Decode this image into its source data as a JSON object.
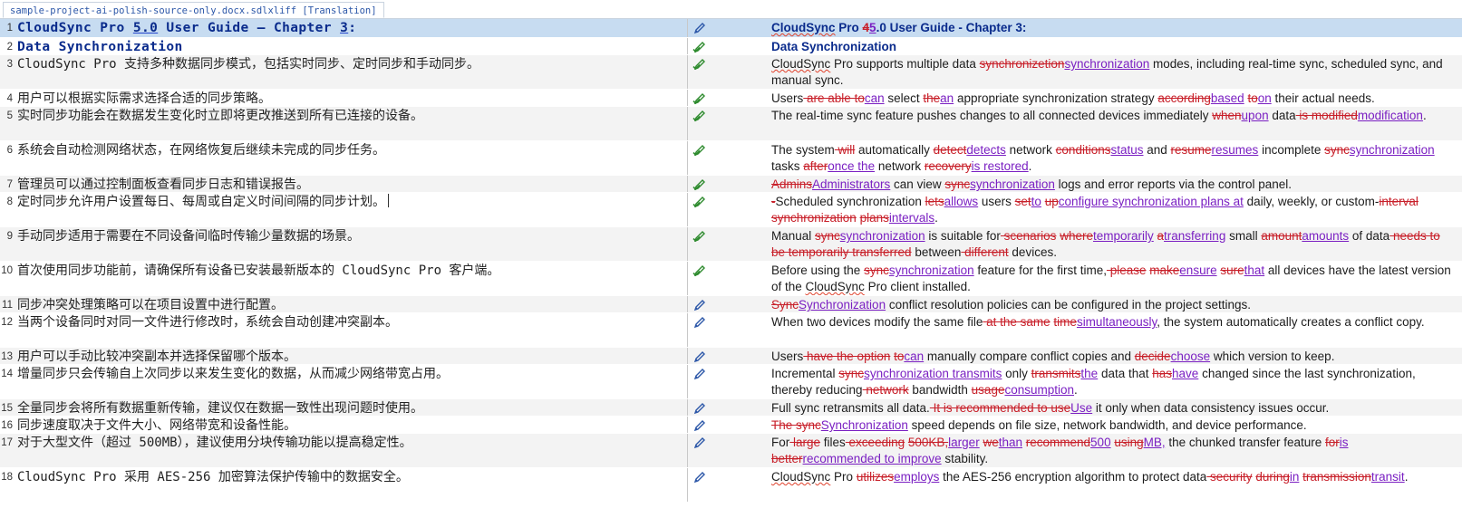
{
  "tab": {
    "label": "sample-project-ai-polish-source-only.docx.sdlxliff [Translation]"
  },
  "colors": {
    "deleted": "#c8202a",
    "inserted": "#7a1fc2",
    "selected_row": "#c7dcf1",
    "title_text": "#0a2b8c",
    "status_icon_blue": "#2c57a8",
    "status_icon_green": "#2e8b2e"
  },
  "rows": [
    {
      "num": "1",
      "title": true,
      "selected": true,
      "status": "draft-edit-icon",
      "source": [
        {
          "t": "CloudSync Pro "
        },
        {
          "t": "5.0",
          "u": true
        },
        {
          "t": " User Guide – Chapter "
        },
        {
          "t": "3",
          "u": true
        },
        {
          "t": ":"
        }
      ],
      "target": [
        {
          "t": "CloudSync",
          "s": "sp"
        },
        {
          "t": " Pro "
        },
        {
          "t": "4",
          "s": "del"
        },
        {
          "t": "5",
          "s": "ins"
        },
        {
          "t": ".0 User Guide - Chapter 3:"
        }
      ]
    },
    {
      "num": "2",
      "title": true,
      "status": "translated-edit-icon",
      "source": [
        {
          "t": "Data Synchronization"
        }
      ],
      "target": [
        {
          "t": "Data Synchronization"
        }
      ]
    },
    {
      "num": "3",
      "status": "translated-edit-icon",
      "source": [
        {
          "t": "CloudSync Pro 支持多种数据同步模式，包括实时同步、定时同步和手动同步。"
        }
      ],
      "target": [
        {
          "t": "CloudSync",
          "s": "sp"
        },
        {
          "t": " Pro supports multiple data "
        },
        {
          "t": "synchronizetion",
          "s": "del"
        },
        {
          "t": "synchronization",
          "s": "ins"
        },
        {
          "t": " modes, including real-time sync, scheduled sync, and manual sync."
        }
      ]
    },
    {
      "num": "4",
      "status": "translated-edit-icon",
      "source": [
        {
          "t": "用户可以根据实际需求选择合适的同步策略。"
        }
      ],
      "target": [
        {
          "t": "Users"
        },
        {
          "t": " are able ",
          "s": "del"
        },
        {
          "t": "to",
          "s": "del"
        },
        {
          "t": "can",
          "s": "ins"
        },
        {
          "t": " select "
        },
        {
          "t": "the",
          "s": "del"
        },
        {
          "t": "an",
          "s": "ins"
        },
        {
          "t": " appropriate synchronization strategy "
        },
        {
          "t": "according",
          "s": "del"
        },
        {
          "t": "based",
          "s": "ins"
        },
        {
          "t": " "
        },
        {
          "t": "to",
          "s": "del"
        },
        {
          "t": "on",
          "s": "ins"
        },
        {
          "t": " their actual needs."
        }
      ]
    },
    {
      "num": "5",
      "status": "translated-edit-icon",
      "source": [
        {
          "t": "实时同步功能会在数据发生变化时立即将更改推送到所有已连接的设备。"
        }
      ],
      "target": [
        {
          "t": "The real-time sync feature pushes changes to all connected devices immediately "
        },
        {
          "t": "when",
          "s": "del"
        },
        {
          "t": "upon",
          "s": "ins"
        },
        {
          "t": " data"
        },
        {
          "t": " is modified",
          "s": "del"
        },
        {
          "t": "modification",
          "s": "ins"
        },
        {
          "t": "."
        }
      ]
    },
    {
      "num": "6",
      "status": "translated-edit-icon",
      "source": [
        {
          "t": "系统会自动检测网络状态，在网络恢复后继续未完成的同步任务。"
        }
      ],
      "target": [
        {
          "t": "The system"
        },
        {
          "t": " will",
          "s": "del"
        },
        {
          "t": " automatically "
        },
        {
          "t": "detect",
          "s": "del"
        },
        {
          "t": "detects",
          "s": "ins"
        },
        {
          "t": " network "
        },
        {
          "t": "conditions",
          "s": "del"
        },
        {
          "t": "status",
          "s": "ins"
        },
        {
          "t": " and "
        },
        {
          "t": "resume",
          "s": "del"
        },
        {
          "t": "resumes",
          "s": "ins"
        },
        {
          "t": " incomplete "
        },
        {
          "t": "sync",
          "s": "del"
        },
        {
          "t": "synchronization",
          "s": "ins"
        },
        {
          "t": " tasks "
        },
        {
          "t": "after",
          "s": "del"
        },
        {
          "t": "once the",
          "s": "ins"
        },
        {
          "t": " network "
        },
        {
          "t": "recovery",
          "s": "del"
        },
        {
          "t": "is restored",
          "s": "ins"
        },
        {
          "t": "."
        }
      ]
    },
    {
      "num": "7",
      "status": "translated-edit-icon",
      "source": [
        {
          "t": "管理员可以通过控制面板查看同步日志和错误报告。"
        }
      ],
      "target": [
        {
          "t": "Admins",
          "s": "del"
        },
        {
          "t": "Administrators",
          "s": "ins"
        },
        {
          "t": " can view "
        },
        {
          "t": "sync",
          "s": "del"
        },
        {
          "t": "synchronization",
          "s": "ins"
        },
        {
          "t": " logs and error reports via the control panel."
        }
      ]
    },
    {
      "num": "8",
      "status": "translated-edit-icon",
      "cursor": true,
      "source": [
        {
          "t": "定时同步允许用户设置每日、每周或自定义时间间隔的同步计划。"
        }
      ],
      "target": [
        {
          "t": "-",
          "s": "del"
        },
        {
          "t": "Scheduled synchronization "
        },
        {
          "t": "lets",
          "s": "del"
        },
        {
          "t": "allows",
          "s": "ins"
        },
        {
          "t": " users "
        },
        {
          "t": "set",
          "s": "del"
        },
        {
          "t": "to",
          "s": "ins"
        },
        {
          "t": " "
        },
        {
          "t": "up",
          "s": "del"
        },
        {
          "t": "configure synchronization plans at",
          "s": "ins"
        },
        {
          "t": " daily, weekly, or custom-"
        },
        {
          "t": "interval synchronization",
          "s": "del"
        },
        {
          "t": " "
        },
        {
          "t": "plans",
          "s": "del"
        },
        {
          "t": "intervals",
          "s": "ins"
        },
        {
          "t": "."
        }
      ]
    },
    {
      "num": "9",
      "status": "translated-edit-icon",
      "source": [
        {
          "t": "手动同步适用于需要在不同设备间临时传输少量数据的场景。"
        }
      ],
      "target": [
        {
          "t": "Manual "
        },
        {
          "t": "sync",
          "s": "del"
        },
        {
          "t": "synchronization",
          "s": "ins"
        },
        {
          "t": " is suitable for"
        },
        {
          "t": " scenarios",
          "s": "del"
        },
        {
          "t": " "
        },
        {
          "t": "where",
          "s": "del"
        },
        {
          "t": "temporarily",
          "s": "ins"
        },
        {
          "t": " "
        },
        {
          "t": "a",
          "s": "del"
        },
        {
          "t": "transferring",
          "s": "ins"
        },
        {
          "t": " small "
        },
        {
          "t": "amount",
          "s": "del"
        },
        {
          "t": "amounts",
          "s": "ins"
        },
        {
          "t": " of data"
        },
        {
          "t": " needs to be temporarily transferred",
          "s": "del"
        },
        {
          "t": " between"
        },
        {
          "t": " different",
          "s": "del"
        },
        {
          "t": " devices."
        }
      ]
    },
    {
      "num": "10",
      "status": "translated-edit-icon",
      "source": [
        {
          "t": "首次使用同步功能前，请确保所有设备已安装最新版本的 CloudSync Pro 客户端。"
        }
      ],
      "target": [
        {
          "t": "Before using the "
        },
        {
          "t": "sync",
          "s": "del"
        },
        {
          "t": "synchronization",
          "s": "ins"
        },
        {
          "t": " feature for the first time,"
        },
        {
          "t": " please",
          "s": "del"
        },
        {
          "t": " "
        },
        {
          "t": "make",
          "s": "del"
        },
        {
          "t": "ensure",
          "s": "ins"
        },
        {
          "t": " "
        },
        {
          "t": "sure",
          "s": "del"
        },
        {
          "t": "that",
          "s": "ins"
        },
        {
          "t": " all devices have the latest version of the "
        },
        {
          "t": "CloudSync",
          "s": "sp"
        },
        {
          "t": " Pro client installed."
        }
      ]
    },
    {
      "num": "11",
      "status": "draft-edit-icon",
      "source": [
        {
          "t": "同步冲突处理策略可以在项目设置中进行配置。"
        }
      ],
      "target": [
        {
          "t": "Sync",
          "s": "del"
        },
        {
          "t": "Synchronization",
          "s": "ins"
        },
        {
          "t": " conflict resolution policies can be configured in the project settings."
        }
      ]
    },
    {
      "num": "12",
      "status": "draft-edit-icon",
      "source": [
        {
          "t": "当两个设备同时对同一文件进行修改时，系统会自动创建冲突副本。"
        }
      ],
      "target": [
        {
          "t": "When two devices modify the same file"
        },
        {
          "t": " at the same",
          "s": "del"
        },
        {
          "t": " "
        },
        {
          "t": "time",
          "s": "del"
        },
        {
          "t": "simultaneously",
          "s": "ins"
        },
        {
          "t": ", the system automatically creates a conflict copy."
        }
      ]
    },
    {
      "num": "13",
      "status": "draft-edit-icon",
      "source": [
        {
          "t": "用户可以手动比较冲突副本并选择保留哪个版本。"
        }
      ],
      "target": [
        {
          "t": "Users"
        },
        {
          "t": " have the option",
          "s": "del"
        },
        {
          "t": " "
        },
        {
          "t": "to",
          "s": "del"
        },
        {
          "t": "can",
          "s": "ins"
        },
        {
          "t": " manually compare conflict copies and "
        },
        {
          "t": "decide",
          "s": "del"
        },
        {
          "t": "choose",
          "s": "ins"
        },
        {
          "t": " which version to keep."
        }
      ]
    },
    {
      "num": "14",
      "status": "draft-edit-icon",
      "source": [
        {
          "t": "增量同步只会传输自上次同步以来发生变化的数据，从而减少网络带宽占用。"
        }
      ],
      "target": [
        {
          "t": "Incremental "
        },
        {
          "t": "sync",
          "s": "del"
        },
        {
          "t": "synchronization transmits",
          "s": "ins"
        },
        {
          "t": " only "
        },
        {
          "t": "transmits",
          "s": "del"
        },
        {
          "t": "the",
          "s": "ins"
        },
        {
          "t": " data that "
        },
        {
          "t": "has",
          "s": "del"
        },
        {
          "t": "have",
          "s": "ins"
        },
        {
          "t": " changed since the last synchronization, thereby reducing"
        },
        {
          "t": " network",
          "s": "del"
        },
        {
          "t": " bandwidth "
        },
        {
          "t": "usage",
          "s": "del"
        },
        {
          "t": "consumption",
          "s": "ins"
        },
        {
          "t": "."
        }
      ]
    },
    {
      "num": "15",
      "status": "draft-edit-icon",
      "source": [
        {
          "t": "全量同步会将所有数据重新传输，建议仅在数据一致性出现问题时使用。"
        }
      ],
      "target": [
        {
          "t": "Full sync retransmits all data."
        },
        {
          "t": " It is recommended to use",
          "s": "del"
        },
        {
          "t": "Use",
          "s": "ins"
        },
        {
          "t": " it only when data consistency issues occur."
        }
      ]
    },
    {
      "num": "16",
      "status": "draft-edit-icon",
      "source": [
        {
          "t": "同步速度取决于文件大小、网络带宽和设备性能。"
        }
      ],
      "target": [
        {
          "t": "The sync",
          "s": "del"
        },
        {
          "t": "Synchronization",
          "s": "ins"
        },
        {
          "t": " speed depends on file size, network bandwidth, and device performance."
        }
      ]
    },
    {
      "num": "17",
      "status": "draft-edit-icon",
      "source": [
        {
          "t": "对于大型文件（超过 500MB），建议使用分块传输功能以提高稳定性。"
        }
      ],
      "target": [
        {
          "t": "For"
        },
        {
          "t": " large",
          "s": "del"
        },
        {
          "t": " files"
        },
        {
          "t": " exceeding",
          "s": "del"
        },
        {
          "t": " "
        },
        {
          "t": "500KB,",
          "s": "del"
        },
        {
          "t": "larger",
          "s": "ins"
        },
        {
          "t": " "
        },
        {
          "t": "we",
          "s": "del"
        },
        {
          "t": "than",
          "s": "ins"
        },
        {
          "t": " "
        },
        {
          "t": "recommend",
          "s": "del"
        },
        {
          "t": "500",
          "s": "ins"
        },
        {
          "t": " "
        },
        {
          "t": "using",
          "s": "del"
        },
        {
          "t": "MB,",
          "s": "ins"
        },
        {
          "t": " the chunked transfer feature "
        },
        {
          "t": "for",
          "s": "del"
        },
        {
          "t": "is",
          "s": "ins"
        },
        {
          "t": " "
        },
        {
          "t": "better",
          "s": "del"
        },
        {
          "t": "recommended to improve",
          "s": "ins"
        },
        {
          "t": " stability."
        }
      ]
    },
    {
      "num": "18",
      "status": "draft-edit-icon",
      "source": [
        {
          "t": "CloudSync Pro 采用 AES-256 加密算法保护传输中的数据安全。"
        }
      ],
      "target": [
        {
          "t": "CloudSync",
          "s": "sp"
        },
        {
          "t": " Pro "
        },
        {
          "t": "utilizes",
          "s": "del"
        },
        {
          "t": "employs",
          "s": "ins"
        },
        {
          "t": " the AES-256 encryption algorithm to protect data"
        },
        {
          "t": " security",
          "s": "del"
        },
        {
          "t": " "
        },
        {
          "t": "during",
          "s": "del"
        },
        {
          "t": "in",
          "s": "ins"
        },
        {
          "t": " "
        },
        {
          "t": "transmission",
          "s": "del"
        },
        {
          "t": "transit",
          "s": "ins"
        },
        {
          "t": "."
        }
      ]
    }
  ]
}
